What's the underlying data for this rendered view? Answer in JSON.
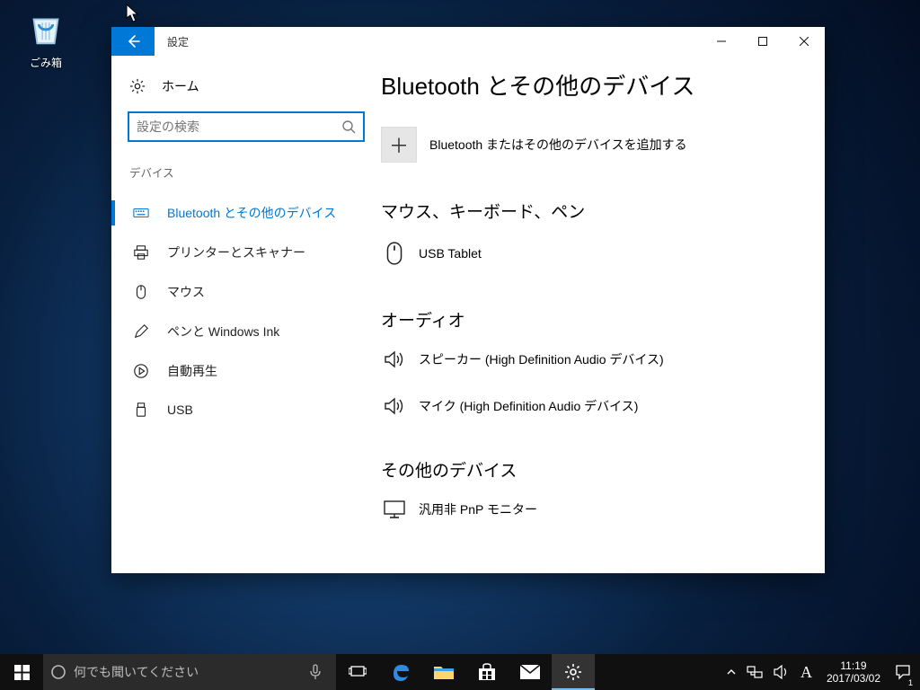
{
  "desktop": {
    "recycle_bin_label": "ごみ箱"
  },
  "window": {
    "title": "設定",
    "home_label": "ホーム",
    "search_placeholder": "設定の検索",
    "minimize": "–",
    "maximize_icon": "▢",
    "close_icon": "✕"
  },
  "sidebar": {
    "category": "デバイス",
    "items": [
      {
        "label": "Bluetooth とその他のデバイス"
      },
      {
        "label": "プリンターとスキャナー"
      },
      {
        "label": "マウス"
      },
      {
        "label": "ペンと Windows Ink"
      },
      {
        "label": "自動再生"
      },
      {
        "label": "USB"
      }
    ]
  },
  "content": {
    "page_title": "Bluetooth とその他のデバイス",
    "add_label": "Bluetooth またはその他のデバイスを追加する",
    "plus": "＋",
    "sections": [
      {
        "heading": "マウス、キーボード、ペン",
        "devices": [
          {
            "name": "USB Tablet"
          }
        ]
      },
      {
        "heading": "オーディオ",
        "devices": [
          {
            "name": "スピーカー (High Definition Audio デバイス)"
          },
          {
            "name": "マイク (High Definition Audio デバイス)"
          }
        ]
      },
      {
        "heading": "その他のデバイス",
        "devices": [
          {
            "name": "汎用非 PnP モニター"
          }
        ]
      }
    ]
  },
  "taskbar": {
    "cortana_placeholder": "何でも聞いてください",
    "ime": "A",
    "time": "11:19",
    "date": "2017/03/02",
    "tray_chevron": "˄",
    "notification_count": "1"
  }
}
